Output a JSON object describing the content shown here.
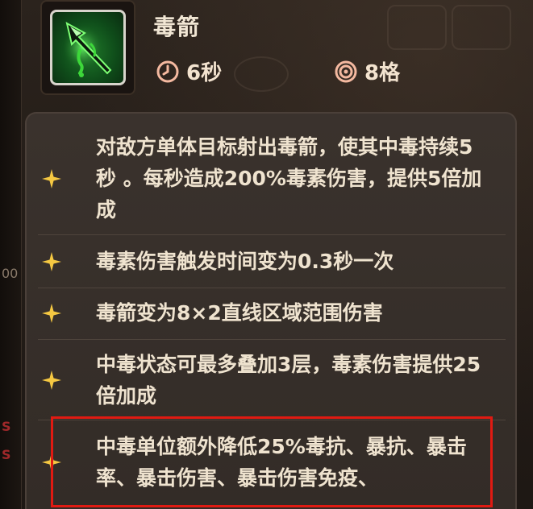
{
  "skill": {
    "name": "毒箭",
    "icon": "poison-arrow-icon",
    "cooldown": "6秒",
    "range": "8格"
  },
  "effects": [
    {
      "text": "对敌方单体目标射出毒箭，使其中毒持续5秒 。每秒造成200%毒素伤害，提供5倍加成"
    },
    {
      "text": "毒素伤害触发时间变为0.3秒一次"
    },
    {
      "text": "毒箭变为8×2直线区域范围伤害"
    },
    {
      "text": "中毒状态可最多叠加3层，毒素伤害提供25倍加成"
    },
    {
      "text": "中毒单位额外降低25%毒抗、暴抗、暴击率、暴击伤害、暴击伤害免疫、"
    }
  ],
  "left_fragments": [
    "00",
    "S",
    "S"
  ],
  "colors": {
    "highlight": "#e01a12",
    "star": "#f5c842",
    "text": "#efe3cf"
  }
}
